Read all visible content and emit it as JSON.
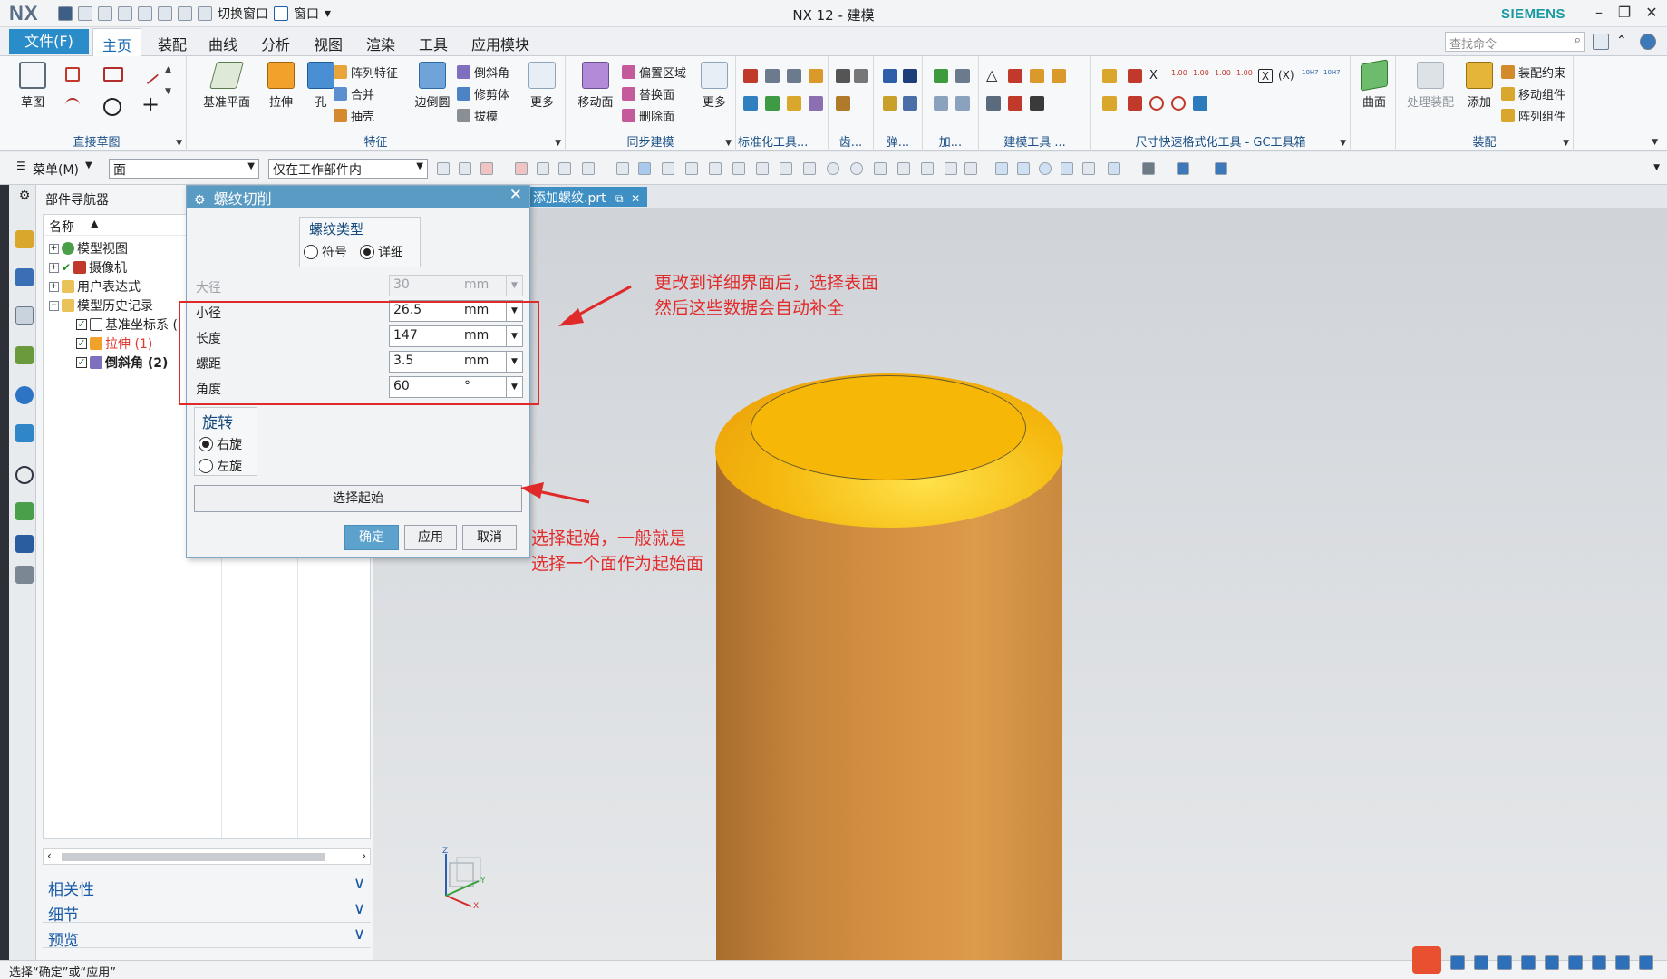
{
  "window": {
    "logo": "NX",
    "title": "NX 12 - 建模",
    "brand": "SIEMENS",
    "qat": {
      "switch_window": "切换窗口",
      "window": "窗口"
    }
  },
  "menu": {
    "file": "文件(F)",
    "tabs": [
      "主页",
      "装配",
      "曲线",
      "分析",
      "视图",
      "渲染",
      "工具",
      "应用模块"
    ],
    "active_tab": "主页",
    "search_placeholder": "查找命令"
  },
  "ribbon": {
    "sketch": {
      "label": "草图",
      "group": "直接草图"
    },
    "feature": {
      "datum_plane": "基准平面",
      "extrude": "拉伸",
      "hole": "孔",
      "pattern": "阵列特征",
      "unite": "合并",
      "shell": "抽壳",
      "edge_blend": "边倒圆",
      "chamfer": "倒斜角",
      "trim_body": "修剪体",
      "draft": "拔模",
      "more": "更多",
      "group": "特征"
    },
    "sync": {
      "move_face": "移动面",
      "offset_region": "偏置区域",
      "replace_face": "替换面",
      "delete_face": "删除面",
      "more": "更多",
      "group": "同步建模"
    },
    "small_groups": [
      "标准化工具...",
      "齿...",
      "弹...",
      "加...",
      "建模工具 ...",
      "尺寸快速格式化工具 - GC工具箱"
    ],
    "surface": {
      "label": "曲面"
    },
    "assembly": {
      "process": "处理装配",
      "add": "添加",
      "constraint": "装配约束",
      "move_component": "移动组件",
      "pattern_component": "阵列组件",
      "group": "装配"
    }
  },
  "toolbar": {
    "menu": "菜单(M)",
    "filter": "面",
    "scope": "仅在工作部件内"
  },
  "navigator": {
    "title": "部件导航器",
    "column": "名称",
    "items": [
      {
        "label": "模型视图"
      },
      {
        "label": "摄像机"
      },
      {
        "label": "用户表达式"
      },
      {
        "label": "模型历史记录"
      },
      {
        "label": "基准坐标系 ("
      },
      {
        "label": "拉伸 (1)"
      },
      {
        "label": "倒斜角 (2)"
      }
    ],
    "panels": [
      "相关性",
      "细节",
      "预览"
    ]
  },
  "graphics": {
    "tab": "添加螺纹.prt"
  },
  "dialog": {
    "title": "螺纹切削",
    "thread_type": {
      "label": "螺纹类型",
      "options": [
        "符号",
        "详细"
      ],
      "selected": "详细"
    },
    "fields": [
      {
        "label": "大径",
        "value": "30",
        "unit": "mm",
        "enabled": false
      },
      {
        "label": "小径",
        "value": "26.5",
        "unit": "mm",
        "enabled": true
      },
      {
        "label": "长度",
        "value": "147",
        "unit": "mm",
        "enabled": true
      },
      {
        "label": "螺距",
        "value": "3.5",
        "unit": "mm",
        "enabled": true
      },
      {
        "label": "角度",
        "value": "60",
        "unit": "°",
        "enabled": true
      }
    ],
    "rotation": {
      "label": "旋转",
      "options": [
        "右旋",
        "左旋"
      ],
      "selected": "右旋"
    },
    "select_start": "选择起始",
    "buttons": {
      "ok": "确定",
      "apply": "应用",
      "cancel": "取消"
    }
  },
  "annotations": {
    "note1": [
      "更改到详细界面后，选择表面",
      "然后这些数据会自动补全"
    ],
    "note2": [
      "选择起始，一般就是",
      "选择一个面作为起始面"
    ]
  },
  "triad": {
    "z": "Z",
    "y": "Y",
    "x": "X"
  },
  "status": {
    "message": "选择“确定”或“应用”"
  },
  "colors": {
    "accent": "#2a8cc8",
    "annotation": "#e02a2a",
    "cylinder": "#d48f42",
    "top": "#f7b706"
  }
}
